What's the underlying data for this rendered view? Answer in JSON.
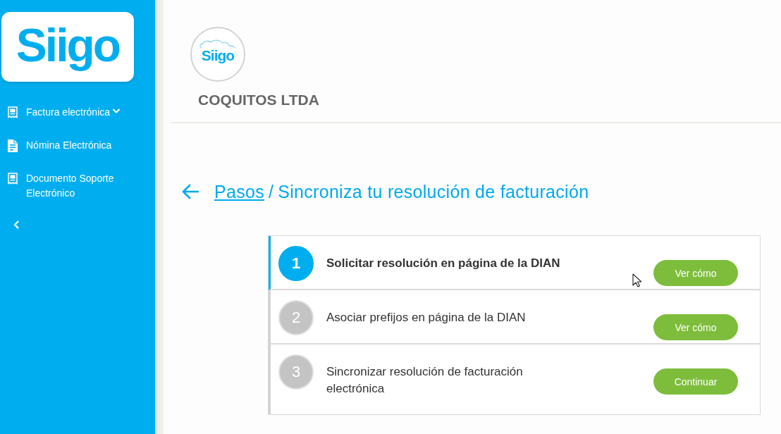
{
  "sidebar": {
    "logo": "Siigo",
    "items": [
      {
        "label": "Factura electrónica",
        "kind": "group",
        "expanded": false
      },
      {
        "label": "Nómina Electrónica",
        "kind": "link"
      },
      {
        "label": "Documento Soporte Electrónico",
        "kind": "link"
      }
    ]
  },
  "company": {
    "logo": "Siigo",
    "name": "COQUITOS LTDA"
  },
  "breadcrumb": {
    "link": "Pasos",
    "separator": "/",
    "current": "Sincroniza tu resolución de facturación"
  },
  "steps": [
    {
      "number": "1",
      "label": "Solicitar resolución en página de la DIAN",
      "selected": true,
      "button": "Ver cómo"
    },
    {
      "number": "2",
      "label": "Asociar prefijos en página de la DIAN",
      "selected": false,
      "button": "Ver cómo"
    },
    {
      "number": "3",
      "label": "Sincronizar resolución de facturación electrónica",
      "selected": false,
      "button": "Continuar"
    }
  ]
}
